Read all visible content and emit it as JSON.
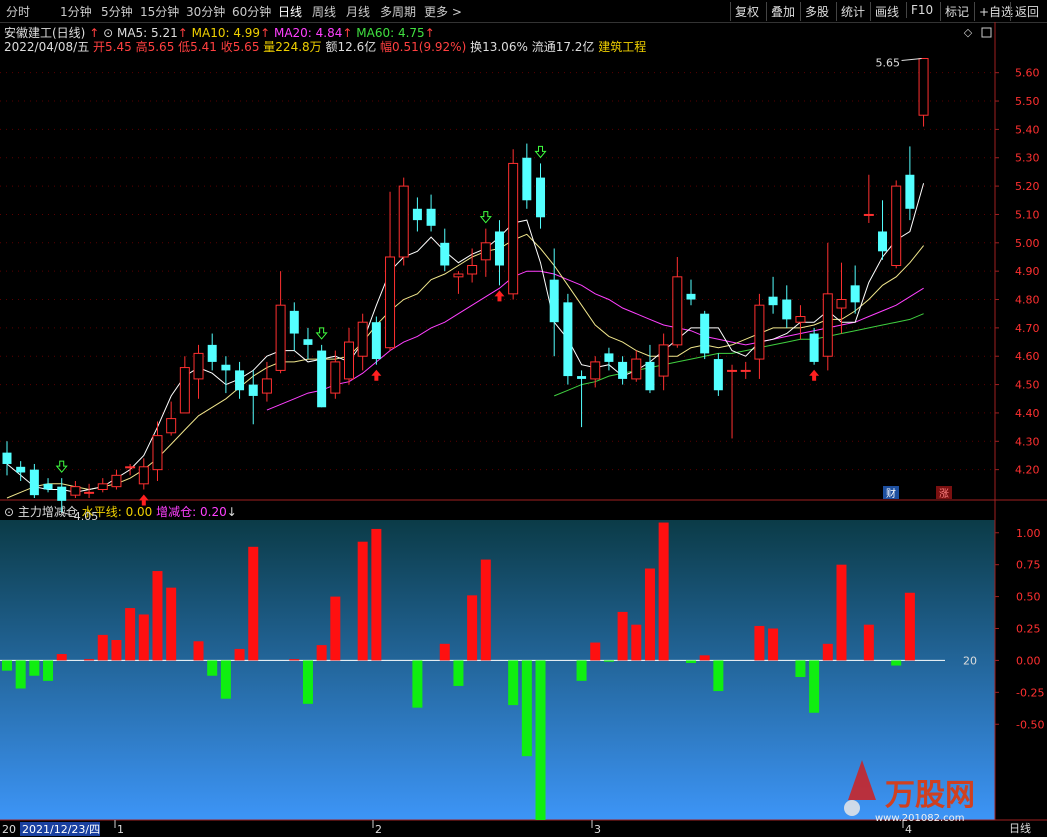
{
  "toolbar": {
    "periods": [
      "分时",
      "1分钟",
      "5分钟",
      "15分钟",
      "30分钟",
      "60分钟",
      "日线",
      "周线",
      "月线",
      "多周期",
      "更多 >"
    ],
    "active_period": "日线",
    "right_buttons": [
      "复权",
      "叠加",
      "多股",
      "统计",
      "画线",
      "F10",
      "标记",
      "+自选",
      "返回"
    ]
  },
  "stock": {
    "name": "安徽建工(日线)",
    "ma5": "MA5: 5.21",
    "ma10": "MA10: 4.99",
    "ma20": "MA20: 4.84",
    "ma60": "MA60: 4.75",
    "date": "2022/04/08/五",
    "open": "开5.45",
    "high": "高5.65",
    "low": "低5.41",
    "close": "收5.65",
    "volume": "量224.8万",
    "amount": "额12.6亿",
    "change": "幅0.51(9.92%)",
    "turnover": "换13.06%",
    "float_cap": "流通17.2亿",
    "sector": "建筑工程"
  },
  "sub_panel": {
    "name": "主力增减仓",
    "level_line": "水平线: 0.00",
    "position": "增减仓: 0.20"
  },
  "markers": {
    "high_label": "5.65",
    "low_label": "4.05",
    "fin_badge": "财",
    "up_badge": "涨",
    "axis_right_label": "20",
    "period_label": "日线"
  },
  "watermark": {
    "title": "万股网",
    "url": "www.201082.com"
  },
  "bottom_axis": {
    "start_date": "2021/12/23/四",
    "prefix": "20",
    "months": [
      "1",
      "2",
      "3",
      "4"
    ]
  },
  "chart_data": [
    {
      "type": "candlestick",
      "title": "安徽建工(日线)",
      "ylim": [
        4.1,
        5.68
      ],
      "yticks": [
        4.2,
        4.3,
        4.4,
        4.5,
        4.6,
        4.7,
        4.8,
        4.9,
        5.0,
        5.1,
        5.2,
        5.3,
        5.4,
        5.5,
        5.6
      ],
      "colors": {
        "up": "#ff3030",
        "down": "#54ffff",
        "ma5": "#ffffff",
        "ma10": "#f0e68c",
        "ma20": "#ff40ff",
        "ma60": "#40d040"
      },
      "candles": [
        [
          4.26,
          4.22,
          4.3,
          4.18
        ],
        [
          4.21,
          4.19,
          4.23,
          4.16
        ],
        [
          4.2,
          4.11,
          4.22,
          4.1
        ],
        [
          4.15,
          4.13,
          4.17,
          4.12
        ],
        [
          4.14,
          4.09,
          4.17,
          4.05
        ],
        [
          4.11,
          4.14,
          4.16,
          4.1
        ],
        [
          4.12,
          4.12,
          4.15,
          4.1
        ],
        [
          4.13,
          4.15,
          4.17,
          4.12
        ],
        [
          4.14,
          4.18,
          4.2,
          4.13
        ],
        [
          4.21,
          4.21,
          4.22,
          4.18
        ],
        [
          4.15,
          4.21,
          4.24,
          4.13
        ],
        [
          4.2,
          4.32,
          4.37,
          4.16
        ],
        [
          4.33,
          4.38,
          4.44,
          4.32
        ],
        [
          4.4,
          4.56,
          4.6,
          4.4
        ],
        [
          4.52,
          4.61,
          4.64,
          4.45
        ],
        [
          4.64,
          4.58,
          4.68,
          4.55
        ],
        [
          4.57,
          4.55,
          4.6,
          4.47
        ],
        [
          4.55,
          4.48,
          4.58,
          4.45
        ],
        [
          4.5,
          4.46,
          4.55,
          4.36
        ],
        [
          4.47,
          4.52,
          4.58,
          4.44
        ],
        [
          4.55,
          4.78,
          4.9,
          4.54
        ],
        [
          4.76,
          4.68,
          4.79,
          4.62
        ],
        [
          4.66,
          4.64,
          4.7,
          4.59
        ],
        [
          4.62,
          4.42,
          4.64,
          4.42
        ],
        [
          4.47,
          4.58,
          4.62,
          4.45
        ],
        [
          4.52,
          4.65,
          4.7,
          4.5
        ],
        [
          4.6,
          4.72,
          4.75,
          4.55
        ],
        [
          4.72,
          4.59,
          4.74,
          4.57
        ],
        [
          4.63,
          4.95,
          5.18,
          4.62
        ],
        [
          4.95,
          5.2,
          5.23,
          4.92
        ],
        [
          5.12,
          5.08,
          5.16,
          5.04
        ],
        [
          5.12,
          5.06,
          5.17,
          5.04
        ],
        [
          5.0,
          4.92,
          5.05,
          4.9
        ],
        [
          4.88,
          4.89,
          4.9,
          4.82
        ],
        [
          4.89,
          4.92,
          4.98,
          4.86
        ],
        [
          4.94,
          5.0,
          5.05,
          4.88
        ],
        [
          5.04,
          4.92,
          5.08,
          4.85
        ],
        [
          4.82,
          5.28,
          5.33,
          4.8
        ],
        [
          5.3,
          5.15,
          5.35,
          5.12
        ],
        [
          5.23,
          5.09,
          5.28,
          5.05
        ],
        [
          4.87,
          4.72,
          4.98,
          4.6
        ],
        [
          4.79,
          4.53,
          4.82,
          4.5
        ],
        [
          4.53,
          4.52,
          4.55,
          4.35
        ],
        [
          4.52,
          4.58,
          4.6,
          4.49
        ],
        [
          4.61,
          4.58,
          4.63,
          4.55
        ],
        [
          4.58,
          4.52,
          4.6,
          4.5
        ],
        [
          4.52,
          4.59,
          4.62,
          4.51
        ],
        [
          4.58,
          4.48,
          4.64,
          4.47
        ],
        [
          4.53,
          4.64,
          4.68,
          4.48
        ],
        [
          4.64,
          4.88,
          4.95,
          4.63
        ],
        [
          4.82,
          4.8,
          4.87,
          4.78
        ],
        [
          4.75,
          4.61,
          4.76,
          4.59
        ],
        [
          4.59,
          4.48,
          4.61,
          4.46
        ],
        [
          4.55,
          4.55,
          4.57,
          4.31
        ],
        [
          4.55,
          4.55,
          4.58,
          4.52
        ],
        [
          4.59,
          4.78,
          4.82,
          4.52
        ],
        [
          4.81,
          4.78,
          4.88,
          4.75
        ],
        [
          4.8,
          4.73,
          4.85,
          4.7
        ],
        [
          4.72,
          4.74,
          4.78,
          4.66
        ],
        [
          4.68,
          4.58,
          4.7,
          4.57
        ],
        [
          4.6,
          4.82,
          5.0,
          4.55
        ],
        [
          4.77,
          4.8,
          4.93,
          4.68
        ],
        [
          4.85,
          4.79,
          4.92,
          4.75
        ],
        [
          5.1,
          5.1,
          5.24,
          5.07
        ],
        [
          5.04,
          4.97,
          5.15,
          4.94
        ],
        [
          4.92,
          5.2,
          5.22,
          4.91
        ],
        [
          5.24,
          5.12,
          5.34,
          5.08
        ],
        [
          5.45,
          5.65,
          5.65,
          5.41
        ]
      ],
      "ma5": [
        4.22,
        4.18,
        4.14,
        4.13,
        4.13,
        4.12,
        4.13,
        4.14,
        4.17,
        4.2,
        4.25,
        4.35,
        4.46,
        4.53,
        4.56,
        4.54,
        4.5,
        4.52,
        4.55,
        4.6,
        4.62,
        4.62,
        4.58,
        4.59,
        4.6,
        4.58,
        4.65,
        4.78,
        4.9,
        4.95,
        4.97,
        5.02,
        4.97,
        4.93,
        4.96,
        4.98,
        5.02,
        5.07,
        5.08,
        4.93,
        4.72,
        4.66,
        4.57,
        4.56,
        4.57,
        4.53,
        4.55,
        4.58,
        4.62,
        4.66,
        4.7,
        4.7,
        4.7,
        4.62,
        4.6,
        4.65,
        4.66,
        4.68,
        4.72,
        4.72,
        4.76,
        4.72,
        4.72,
        4.86,
        4.95,
        5.01,
        5.04,
        5.21
      ],
      "ma10": [
        4.1,
        4.12,
        4.14,
        4.15,
        4.15,
        4.14,
        4.13,
        4.14,
        4.15,
        4.17,
        4.2,
        4.24,
        4.29,
        4.34,
        4.39,
        4.42,
        4.45,
        4.49,
        4.53,
        4.56,
        4.58,
        4.58,
        4.59,
        4.59,
        4.59,
        4.6,
        4.65,
        4.71,
        4.76,
        4.8,
        4.82,
        4.87,
        4.89,
        4.92,
        4.95,
        4.97,
        4.98,
        5.01,
        5.03,
        4.98,
        4.92,
        4.85,
        4.78,
        4.71,
        4.67,
        4.65,
        4.62,
        4.6,
        4.6,
        4.6,
        4.63,
        4.64,
        4.63,
        4.64,
        4.66,
        4.68,
        4.7,
        4.7,
        4.7,
        4.71,
        4.73,
        4.73,
        4.76,
        4.8,
        4.85,
        4.88,
        4.93,
        4.99
      ],
      "ma20": [
        null,
        null,
        null,
        null,
        null,
        null,
        null,
        null,
        null,
        null,
        null,
        null,
        null,
        null,
        null,
        null,
        null,
        null,
        null,
        4.41,
        4.43,
        4.45,
        4.47,
        4.48,
        4.5,
        4.51,
        4.54,
        4.58,
        4.62,
        4.65,
        4.67,
        4.7,
        4.72,
        4.75,
        4.78,
        4.81,
        4.84,
        4.88,
        4.9,
        4.9,
        4.89,
        4.87,
        4.85,
        4.82,
        4.8,
        4.77,
        4.75,
        4.73,
        4.71,
        4.7,
        4.69,
        4.67,
        4.66,
        4.65,
        4.64,
        4.65,
        4.66,
        4.67,
        4.68,
        4.69,
        4.7,
        4.71,
        4.72,
        4.74,
        4.76,
        4.78,
        4.81,
        4.84
      ],
      "ma60": [
        null,
        null,
        null,
        null,
        null,
        null,
        null,
        null,
        null,
        null,
        null,
        null,
        null,
        null,
        null,
        null,
        null,
        null,
        null,
        null,
        null,
        null,
        null,
        null,
        null,
        null,
        null,
        null,
        null,
        null,
        null,
        null,
        null,
        null,
        null,
        null,
        null,
        null,
        null,
        null,
        4.46,
        4.48,
        4.5,
        4.51,
        4.53,
        4.54,
        4.55,
        4.56,
        4.57,
        4.58,
        4.59,
        4.6,
        4.61,
        4.61,
        4.62,
        4.63,
        4.64,
        4.65,
        4.66,
        4.66,
        4.67,
        4.68,
        4.69,
        4.7,
        4.71,
        4.72,
        4.73,
        4.75
      ],
      "signals": [
        {
          "index": 4,
          "kind": "down"
        },
        {
          "index": 10,
          "kind": "up"
        },
        {
          "index": 23,
          "kind": "down"
        },
        {
          "index": 27,
          "kind": "up"
        },
        {
          "index": 35,
          "kind": "down"
        },
        {
          "index": 36,
          "kind": "up"
        },
        {
          "index": 39,
          "kind": "down"
        },
        {
          "index": 59,
          "kind": "up"
        }
      ]
    },
    {
      "type": "bar",
      "title": "主力增减仓",
      "ylim": [
        -1.25,
        1.1
      ],
      "yticks": [
        1.0,
        0.75,
        0.5,
        0.25,
        0.0,
        -0.25,
        -0.5
      ],
      "values": [
        -0.08,
        -0.22,
        -0.12,
        -0.16,
        0.05,
        0.0,
        0.01,
        0.2,
        0.16,
        0.41,
        0.36,
        0.7,
        0.57,
        0.0,
        0.15,
        -0.12,
        -0.3,
        0.09,
        0.89,
        0.0,
        0.0,
        0.01,
        -0.34,
        0.12,
        0.5,
        0.0,
        0.93,
        1.03,
        0.0,
        0.0,
        -0.37,
        0.0,
        0.13,
        -0.2,
        0.51,
        0.79,
        0.0,
        -0.35,
        -0.75,
        -1.25,
        0.0,
        0.0,
        -0.16,
        0.14,
        -0.01,
        0.38,
        0.28,
        0.72,
        1.08,
        0.0,
        -0.02,
        0.04,
        -0.24,
        0.0,
        0.0,
        0.27,
        0.25,
        0.0,
        -0.13,
        -0.41,
        0.13,
        0.75,
        0.0,
        0.28,
        0.0,
        -0.04,
        0.53,
        0.0
      ]
    }
  ]
}
